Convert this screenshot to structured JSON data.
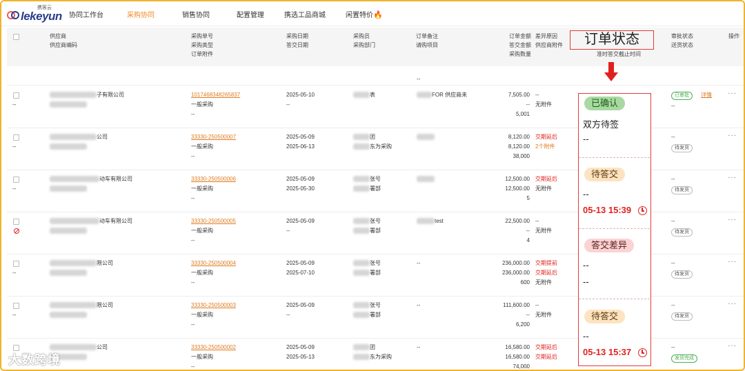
{
  "nav": {
    "logo_text": "lekeyun",
    "logo_sub": "携客云",
    "items": [
      "协同工作台",
      "采购协同",
      "销售协同",
      "配置管理",
      "携选工品商城",
      "闲置特价"
    ]
  },
  "header": {
    "supplier": "供应商",
    "supplier_code": "供应商编码",
    "po_no": "采购单号",
    "po_type": "采购类型",
    "po_attach": "订单附件",
    "po_date": "采购日期",
    "reply_date": "答交日期",
    "buyer": "采购员",
    "dept": "采购部门",
    "remark": "订单备注",
    "project": "请购项目",
    "amount": "订单金额",
    "reply_amount": "答交金额",
    "qty": "采购数量",
    "diff_reason": "差异原因",
    "supplier_attach": "供应商附件",
    "order_status": "订单状态",
    "deadline": "准时答交截止时间",
    "approval": "审批状态",
    "delivery": "送货状态",
    "ops": "操作"
  },
  "partial_row": {
    "dash": "--"
  },
  "rows": [
    {
      "supplier": "子有限公司",
      "po_no": "1017468348265837",
      "type": "一般采购",
      "attach": "--",
      "date": "2025-05-10",
      "reply": "--",
      "buyer": "表",
      "remark": "FOR 供应商未",
      "amount": "7,505.00",
      "reply_amount": "--",
      "qty": "5,001",
      "diff": "--",
      "supp_attach": "无附件",
      "approval": "已审批",
      "approval_link": "详情",
      "delivery": "--"
    },
    {
      "supplier": "公司",
      "po_no": "33330-250500007",
      "type": "一般采购",
      "attach": "--",
      "date": "2025-05-09",
      "reply": "2025-06-13",
      "buyer": "团",
      "dept": "东为采购",
      "remark": "",
      "amount": "8,120.00",
      "reply_amount": "8,120.00",
      "qty": "38,000",
      "diff": "交期延后",
      "supp_attach": "2个附件",
      "approval": "--",
      "delivery": "待发货"
    },
    {
      "supplier": "动车有限公司",
      "po_no": "33330-250500006",
      "type": "一般采购",
      "attach": "--",
      "date": "2025-05-09",
      "reply": "2025-05-30",
      "buyer": "张号",
      "dept": "署部",
      "remark": "",
      "amount": "12,500.00",
      "reply_amount": "12,500.00",
      "qty": "5",
      "diff": "交期延后",
      "supp_attach": "无附件",
      "approval": "--",
      "delivery": "待发货"
    },
    {
      "supplier": "动车有限公司",
      "po_no": "33330-250500005",
      "type": "一般采购",
      "attach": "--",
      "date": "2025-05-09",
      "reply": "--",
      "buyer": "张号",
      "dept": "署部",
      "remark": "test",
      "amount": "22,500.00",
      "reply_amount": "--",
      "qty": "4",
      "diff": "--",
      "supp_attach": "无附件",
      "approval": "--",
      "delivery": "待发货"
    },
    {
      "supplier": "限公司",
      "po_no": "33330-250500004",
      "type": "一般采购",
      "attach": "--",
      "date": "2025-05-09",
      "reply": "2025-07-10",
      "buyer": "张号",
      "dept": "署部",
      "remark": "--",
      "amount": "236,000.00",
      "reply_amount": "236,000.00",
      "qty": "600",
      "diff": "交期提前",
      "diff2": "交期延后",
      "supp_attach": "无附件",
      "approval": "--",
      "delivery": "待发货"
    },
    {
      "supplier": "限公司",
      "po_no": "33330-250500003",
      "type": "一般采购",
      "attach": "--",
      "date": "2025-05-09",
      "reply": "--",
      "buyer": "张号",
      "dept": "署部",
      "remark": "--",
      "amount": "111,600.00",
      "reply_amount": "--",
      "qty": "6,200",
      "diff": "--",
      "supp_attach": "无附件",
      "approval": "--",
      "delivery": "待发货"
    },
    {
      "supplier": "公司",
      "po_no": "33330-250500002",
      "type": "一般采购",
      "attach": "--",
      "date": "2025-05-09",
      "reply": "2025-05-13",
      "buyer": "团",
      "dept": "东为采购",
      "remark": "--",
      "amount": "16,580.00",
      "reply_amount": "16,580.00",
      "qty": "74,000",
      "diff": "交期延后",
      "diff2": "交期延后",
      "supp_attach": "",
      "approval": "--",
      "delivery": "发货完成"
    }
  ],
  "status_panel": {
    "s1_pill": "已确认",
    "s1_text": "双方待签",
    "s1_dash": "--",
    "s2_pill": "待答交",
    "s2_dash": "--",
    "s2_time": "05-13 15:39",
    "s3_pill": "答交差异",
    "s3_dash1": "--",
    "s3_dash2": "--",
    "s4_pill": "待答交",
    "s4_dash": "--",
    "s4_time": "05-13 15:37"
  },
  "dash": "--",
  "more": "···",
  "watermark": "大数跨境",
  "colors": {
    "accent": "#f08a24",
    "highlight": "#e03a3a",
    "link": "#e07a1f"
  }
}
